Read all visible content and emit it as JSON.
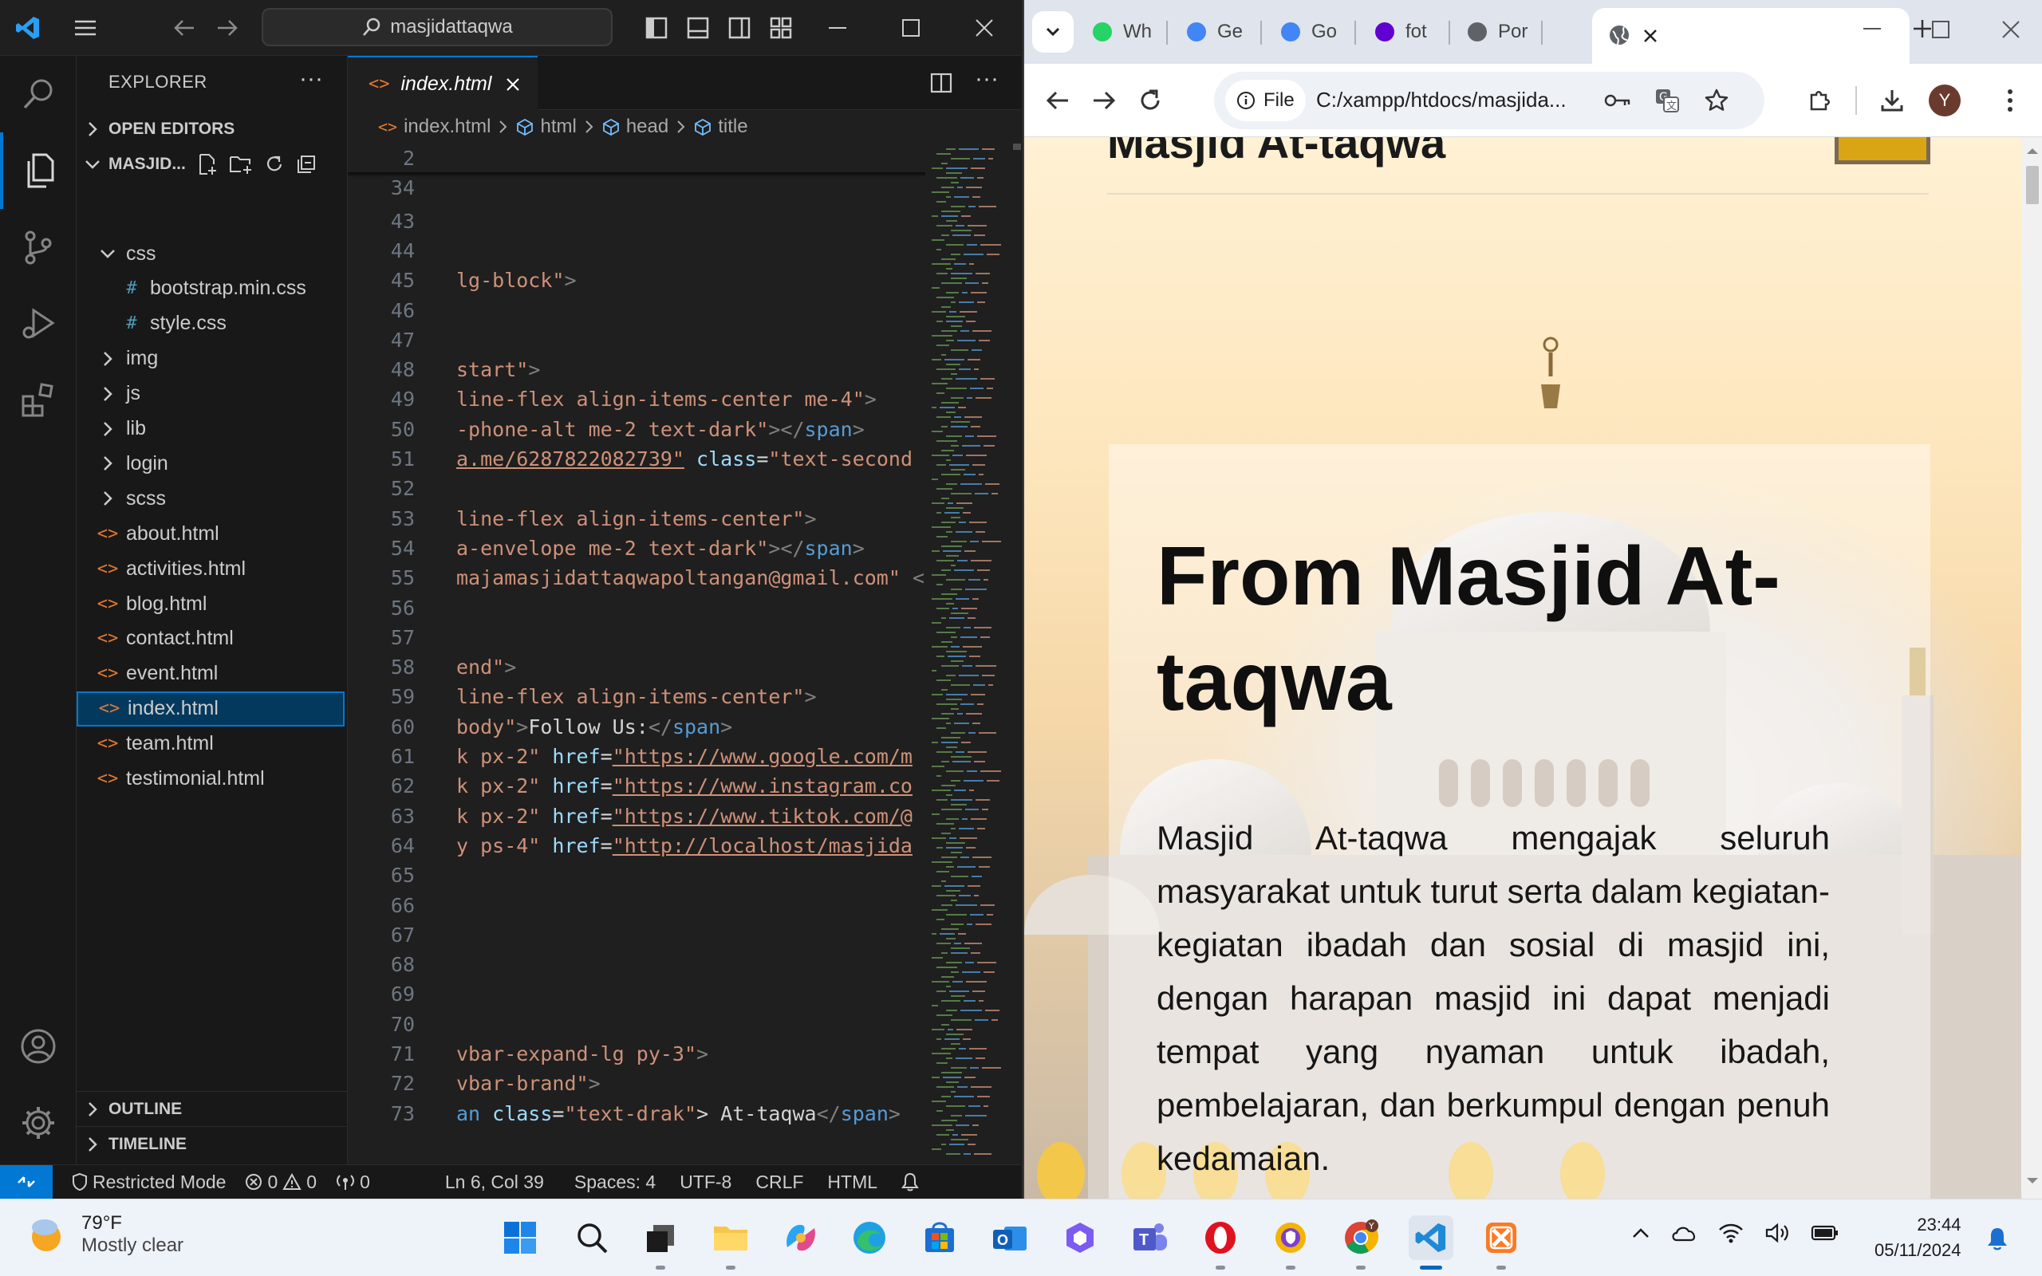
{
  "vscode": {
    "search_text": "masjidattaqwa",
    "sidebar_title": "EXPLORER",
    "open_editors": "OPEN EDITORS",
    "workspace": "MASJID...",
    "tree": [
      {
        "label": "css",
        "type": "folder-open",
        "depth": 1
      },
      {
        "label": "bootstrap.min.css",
        "type": "css",
        "depth": 2
      },
      {
        "label": "style.css",
        "type": "css",
        "depth": 2
      },
      {
        "label": "img",
        "type": "folder",
        "depth": 1
      },
      {
        "label": "js",
        "type": "folder",
        "depth": 1
      },
      {
        "label": "lib",
        "type": "folder",
        "depth": 1
      },
      {
        "label": "login",
        "type": "folder",
        "depth": 1
      },
      {
        "label": "scss",
        "type": "folder",
        "depth": 1
      },
      {
        "label": "about.html",
        "type": "html",
        "depth": 1
      },
      {
        "label": "activities.html",
        "type": "html",
        "depth": 1
      },
      {
        "label": "blog.html",
        "type": "html",
        "depth": 1
      },
      {
        "label": "contact.html",
        "type": "html",
        "depth": 1
      },
      {
        "label": "event.html",
        "type": "html",
        "depth": 1
      },
      {
        "label": "index.html",
        "type": "html",
        "depth": 1,
        "selected": true
      },
      {
        "label": "team.html",
        "type": "html",
        "depth": 1
      },
      {
        "label": "testimonial.html",
        "type": "html",
        "depth": 1
      }
    ],
    "outline": "OUTLINE",
    "timeline": "TIMELINE",
    "tab_label": "index.html",
    "breadcrumb": [
      "index.html",
      "html",
      "head",
      "title"
    ],
    "code_lines": [
      {
        "n": "2",
        "tokens": []
      },
      {
        "n": "34",
        "tokens": []
      },
      {
        "n": "43",
        "tokens": []
      },
      {
        "n": "44",
        "tokens": []
      },
      {
        "n": "45",
        "tokens": [
          [
            "lg-block\"",
            "t-str"
          ],
          [
            ">",
            "t-punc"
          ]
        ]
      },
      {
        "n": "46",
        "tokens": []
      },
      {
        "n": "47",
        "tokens": []
      },
      {
        "n": "48",
        "tokens": [
          [
            "start\"",
            "t-str"
          ],
          [
            ">",
            "t-punc"
          ]
        ]
      },
      {
        "n": "49",
        "tokens": [
          [
            "line-flex align-items-center me-4\"",
            "t-str"
          ],
          [
            ">",
            "t-punc"
          ]
        ]
      },
      {
        "n": "50",
        "tokens": [
          [
            "-phone-alt me-2 text-dark\"",
            "t-str"
          ],
          [
            "></",
            "t-punc"
          ],
          [
            "span",
            "t-tag"
          ],
          [
            ">",
            "t-punc"
          ]
        ]
      },
      {
        "n": "51",
        "tokens": [
          [
            "a.me/6287822082739\"",
            "t-url"
          ],
          [
            " ",
            "t-txt"
          ],
          [
            "class",
            "t-attr"
          ],
          [
            "=",
            "t-txt"
          ],
          [
            "\"text-second",
            "t-str"
          ]
        ]
      },
      {
        "n": "52",
        "tokens": []
      },
      {
        "n": "53",
        "tokens": [
          [
            "line-flex align-items-center\"",
            "t-str"
          ],
          [
            ">",
            "t-punc"
          ]
        ]
      },
      {
        "n": "54",
        "tokens": [
          [
            "a-envelope me-2 text-dark\"",
            "t-str"
          ],
          [
            "></",
            "t-punc"
          ],
          [
            "span",
            "t-tag"
          ],
          [
            ">",
            "t-punc"
          ]
        ]
      },
      {
        "n": "55",
        "tokens": [
          [
            "majamasjidattaqwapoltangan@gmail.com\"",
            "t-str"
          ],
          [
            " <",
            "t-punc"
          ]
        ]
      },
      {
        "n": "56",
        "tokens": []
      },
      {
        "n": "57",
        "tokens": []
      },
      {
        "n": "58",
        "tokens": [
          [
            "end\"",
            "t-str"
          ],
          [
            ">",
            "t-punc"
          ]
        ]
      },
      {
        "n": "59",
        "tokens": [
          [
            "line-flex align-items-center\"",
            "t-str"
          ],
          [
            ">",
            "t-punc"
          ]
        ]
      },
      {
        "n": "60",
        "tokens": [
          [
            "body\"",
            "t-str"
          ],
          [
            ">",
            "t-punc"
          ],
          [
            "Follow Us:",
            "t-txt"
          ],
          [
            "</",
            "t-punc"
          ],
          [
            "span",
            "t-tag"
          ],
          [
            ">",
            "t-punc"
          ]
        ]
      },
      {
        "n": "61",
        "tokens": [
          [
            "k px-2\"",
            "t-str"
          ],
          [
            " ",
            "t-txt"
          ],
          [
            "href",
            "t-attr"
          ],
          [
            "=",
            "t-txt"
          ],
          [
            "\"https://www.google.com/m",
            "t-url"
          ]
        ]
      },
      {
        "n": "62",
        "tokens": [
          [
            "k px-2\"",
            "t-str"
          ],
          [
            " ",
            "t-txt"
          ],
          [
            "href",
            "t-attr"
          ],
          [
            "=",
            "t-txt"
          ],
          [
            "\"https://www.instagram.co",
            "t-url"
          ]
        ]
      },
      {
        "n": "63",
        "tokens": [
          [
            "k px-2\"",
            "t-str"
          ],
          [
            " ",
            "t-txt"
          ],
          [
            "href",
            "t-attr"
          ],
          [
            "=",
            "t-txt"
          ],
          [
            "\"https://www.tiktok.com/@",
            "t-url"
          ]
        ]
      },
      {
        "n": "64",
        "tokens": [
          [
            "y ps-4\"",
            "t-str"
          ],
          [
            " ",
            "t-txt"
          ],
          [
            "href",
            "t-attr"
          ],
          [
            "=",
            "t-txt"
          ],
          [
            "\"http://localhost/masjida",
            "t-url"
          ]
        ]
      },
      {
        "n": "65",
        "tokens": []
      },
      {
        "n": "66",
        "tokens": []
      },
      {
        "n": "67",
        "tokens": []
      },
      {
        "n": "68",
        "tokens": []
      },
      {
        "n": "69",
        "tokens": []
      },
      {
        "n": "70",
        "tokens": []
      },
      {
        "n": "71",
        "tokens": [
          [
            "vbar-expand-lg py-3\"",
            "t-str"
          ],
          [
            ">",
            "t-punc"
          ]
        ]
      },
      {
        "n": "72",
        "tokens": [
          [
            "vbar-brand\"",
            "t-str"
          ],
          [
            ">",
            "t-punc"
          ]
        ]
      },
      {
        "n": "73",
        "tokens": [
          [
            "an ",
            "t-tag"
          ],
          [
            "class",
            "t-attr"
          ],
          [
            "=",
            "t-txt"
          ],
          [
            "\"text-drak\"",
            "t-str"
          ],
          [
            "> At-taqwa",
            "t-txt"
          ],
          [
            "</",
            "t-punc"
          ],
          [
            "span",
            "t-tag"
          ],
          [
            ">",
            "t-punc"
          ]
        ]
      }
    ],
    "status": {
      "mode": "Restricted Mode",
      "errors": "0",
      "warnings": "0",
      "ports": "0",
      "position": "Ln 6, Col 39",
      "spaces": "Spaces: 4",
      "encoding": "UTF-8",
      "eol": "CRLF",
      "language": "HTML"
    }
  },
  "browser": {
    "tabs": [
      {
        "label": "Wh",
        "icon": "whatsapp-icon",
        "color": "#25d366"
      },
      {
        "label": "Ge",
        "icon": "gemini-icon",
        "color": "#4285f4"
      },
      {
        "label": "Go",
        "icon": "google-translate-icon",
        "color": "#4285f4"
      },
      {
        "label": "fot",
        "icon": "yahoo-icon",
        "color": "#6001d2"
      },
      {
        "label": "Por",
        "icon": "globe-icon",
        "color": "#5f6368"
      }
    ],
    "omnibox_chip": "File",
    "url": "C:/xampp/htdocs/masjida...",
    "avatar_letter": "Y",
    "page": {
      "brand": "Masjid At-taqwa",
      "hero_title": "From Masjid At-taqwa",
      "hero_text": "Masjid At-taqwa mengajak seluruh masyarakat untuk turut serta dalam kegiatan-kegiatan ibadah dan sosial di masjid ini, dengan harapan masjid ini dapat menjadi tempat yang nyaman untuk ibadah, pembelajaran, dan berkumpul dengan penuh kedamaian."
    }
  },
  "taskbar": {
    "weather_temp": "79°F",
    "weather_desc": "Mostly clear",
    "time": "23:44",
    "date": "05/11/2024"
  }
}
